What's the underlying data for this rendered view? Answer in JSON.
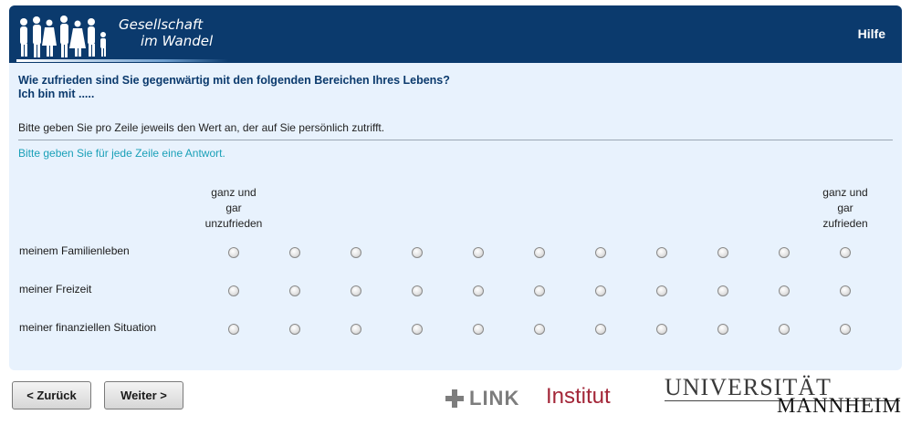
{
  "header": {
    "logo_line1": "Gesellschaft",
    "logo_line2": "im Wandel",
    "help_label": "Hilfe"
  },
  "question": {
    "title_line1": "Wie zufrieden sind Sie gegenwärtig mit den folgenden Bereichen Ihres Lebens?",
    "title_line2": "Ich bin mit .....",
    "instruction": "Bitte geben Sie pro Zeile jeweils den Wert an, der auf Sie persönlich zutrifft.",
    "hint": "Bitte geben Sie für jede Zeile eine Antwort."
  },
  "scale": {
    "left_line1": "ganz und",
    "left_line2": "gar",
    "left_line3": "unzufrieden",
    "right_line1": "ganz und",
    "right_line2": "gar",
    "right_line3": "zufrieden",
    "points": 11
  },
  "rows": [
    {
      "label": "meinem Familienleben",
      "selected": null
    },
    {
      "label": "meiner Freizeit",
      "selected": null
    },
    {
      "label": "meiner finanziellen Situation",
      "selected": null
    }
  ],
  "nav": {
    "back_label": "< Zurück",
    "next_label": "Weiter >"
  },
  "logos": {
    "link_word": "LINK",
    "institut_word": "Institut",
    "uni_line1": "UNIVERSITÄT",
    "uni_line2": "MANNHEIM"
  },
  "colors": {
    "header_bg": "#0b3a6d",
    "panel_bg": "#e8f2fd",
    "question_text": "#0b3a6d",
    "hint_text": "#1aa0b8",
    "institut_red": "#a32638"
  }
}
